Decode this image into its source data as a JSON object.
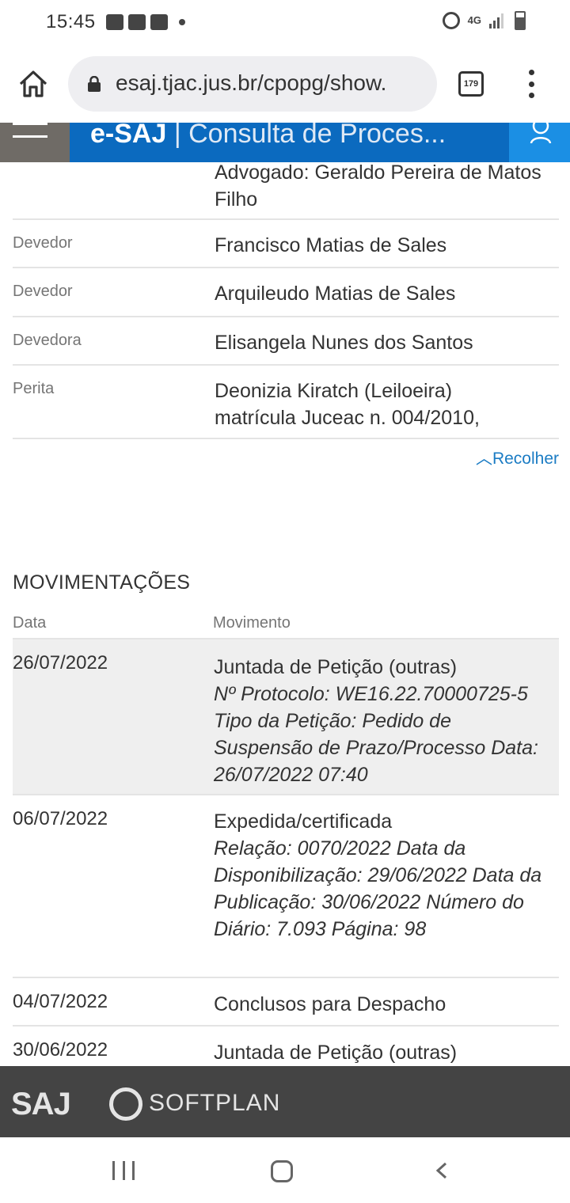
{
  "status": {
    "time": "15:45",
    "network": "4G",
    "icons": [
      "voicemail-icon",
      "youtube-icon",
      "message-icon",
      "alarm-icon",
      "signal-icon",
      "battery-icon"
    ]
  },
  "browser": {
    "url": "esaj.tjac.jus.br/cpopg/show.",
    "tab_count": "179"
  },
  "header": {
    "brand": "e-SAJ",
    "separator": "|",
    "subtitle": "Consulta de Proces..."
  },
  "parties": [
    {
      "role": "",
      "name": "Advogado:  Geraldo Pereira de Matos Filho"
    },
    {
      "role": "Devedor",
      "name": "Francisco Matias de Sales"
    },
    {
      "role": "Devedor",
      "name": "Arquileudo Matias de Sales"
    },
    {
      "role": "Devedora",
      "name": "Elisangela Nunes dos Santos"
    },
    {
      "role": "Perita",
      "name": "Deonizia Kiratch (Leiloeira) matrícula  Juceac n. 004/2010,"
    }
  ],
  "collapse_label": "Recolher",
  "movements": {
    "title": "MOVIMENTAÇÕES",
    "col_date": "Data",
    "col_movement": "Movimento",
    "rows": [
      {
        "date": "26/07/2022",
        "main": "Juntada de Petição (outras)",
        "detail": "Nº Protocolo: WE16.22.70000725-5 Tipo da Petição: Pedido de Suspensão de Prazo/Processo Data: 26/07/2022 07:40"
      },
      {
        "date": "06/07/2022",
        "main": "Expedida/certificada",
        "detail": "Relação: 0070/2022 Data da Disponibilização: 29/06/2022 Data da Publicação: 30/06/2022 Número do Diário: 7.093 Página: 98"
      },
      {
        "date": "04/07/2022",
        "main": "Conclusos para Despacho",
        "detail": ""
      },
      {
        "date": "30/06/2022",
        "main": "Juntada de Petição (outras)",
        "detail": ""
      }
    ]
  },
  "footer": {
    "saj_logo": "SAJ",
    "softplan_logo": "SOFTPLAN"
  }
}
